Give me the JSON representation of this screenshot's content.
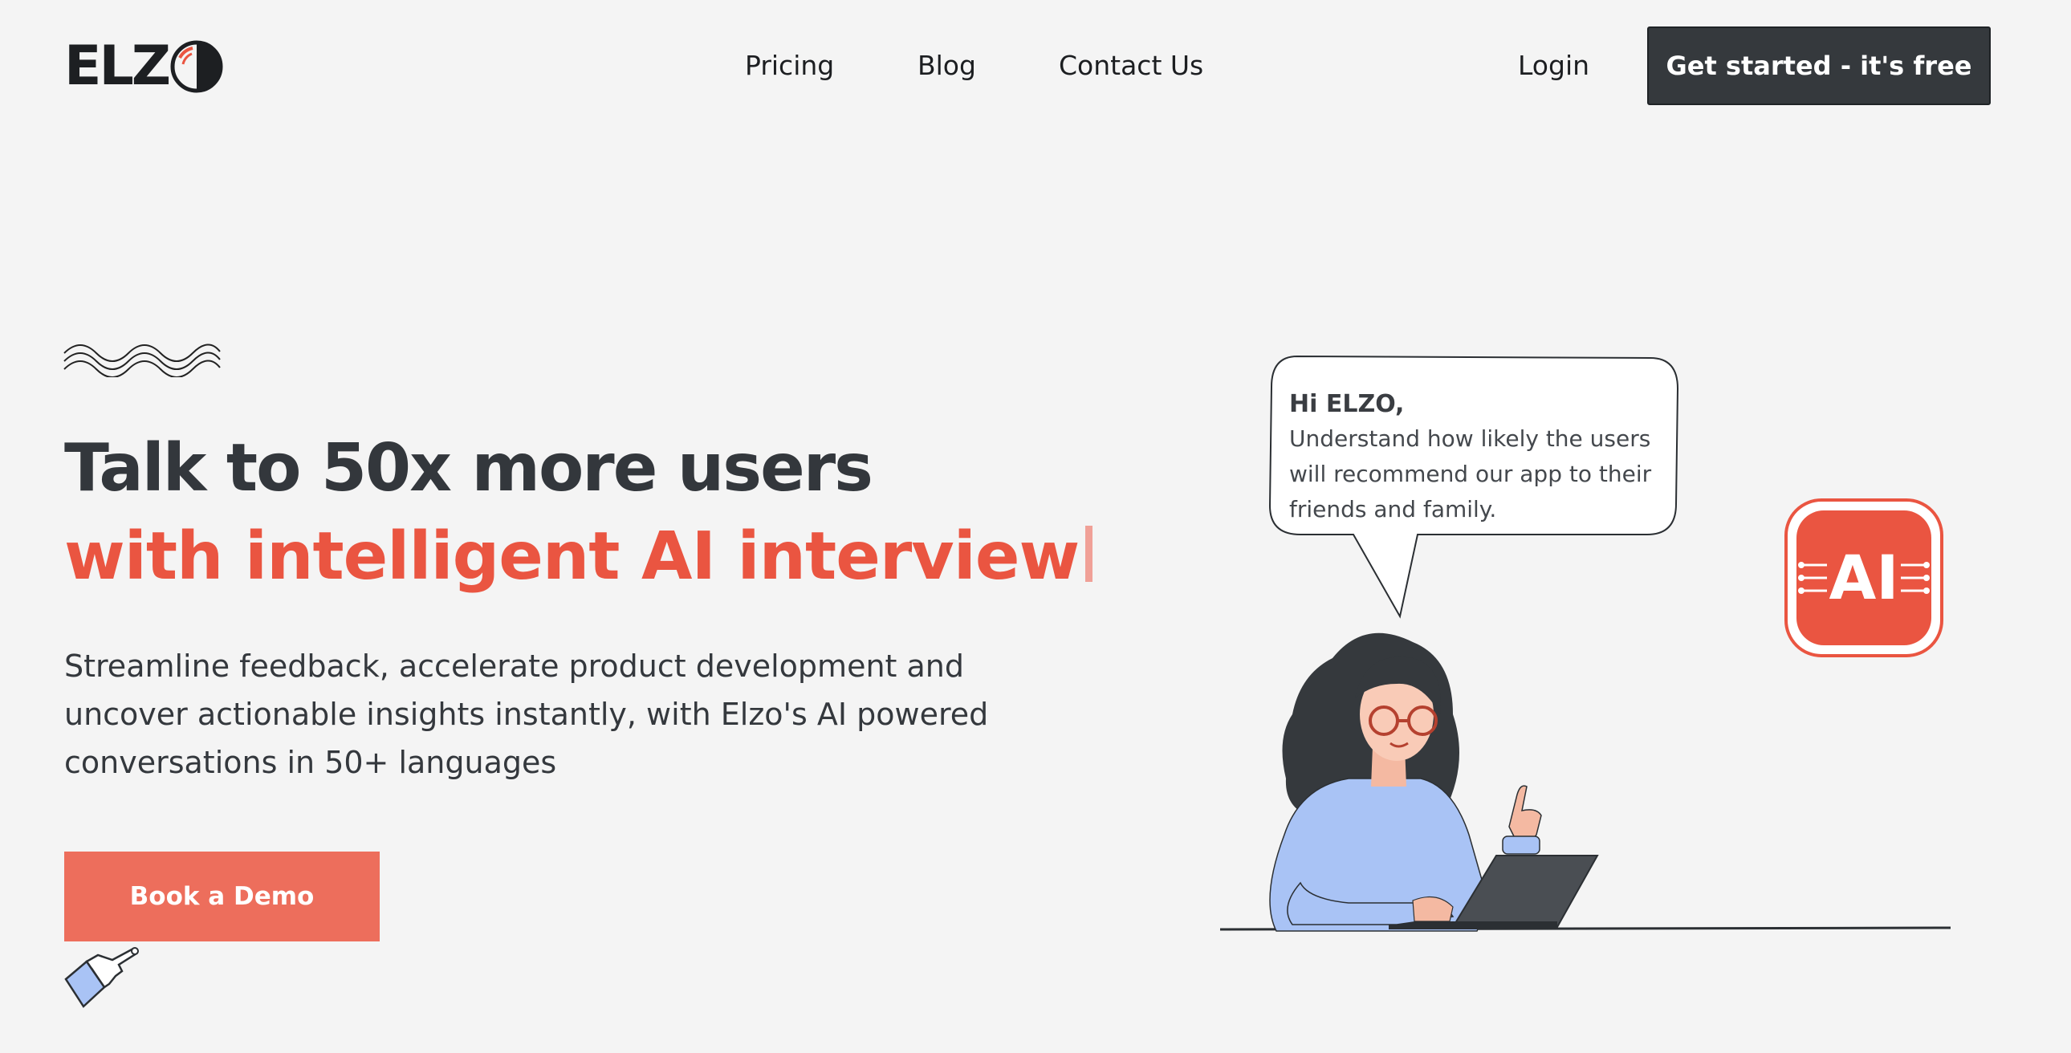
{
  "brand": {
    "name": "ELZ",
    "mark": "O"
  },
  "nav": {
    "pricing": "Pricing",
    "blog": "Blog",
    "contact": "Contact Us",
    "login": "Login",
    "cta": "Get started - it's free"
  },
  "hero": {
    "title_line1": "Talk to 50x more users",
    "title_line2": "with intelligent AI interview",
    "lead": "Streamline feedback, accelerate product development and uncover actionable insights instantly, with Elzo's AI powered conversations in 50+ languages",
    "demo_button": "Book a Demo"
  },
  "bubble": {
    "greeting": "Hi ELZO,",
    "message": "Understand how likely the users will recommend our app to their friends and family."
  },
  "badge": {
    "label": "AI"
  },
  "colors": {
    "accent": "#ea5541",
    "button_dark": "#35393d",
    "button_coral": "#ed6e5c",
    "background": "#f4f4f4"
  }
}
